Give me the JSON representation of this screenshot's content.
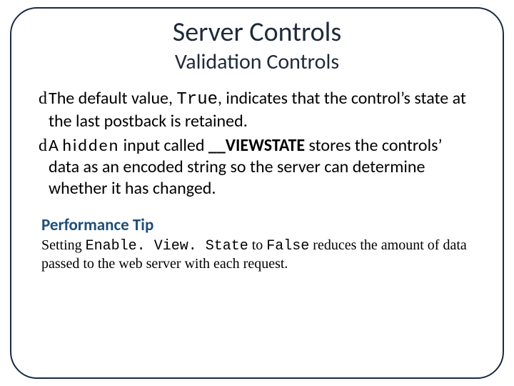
{
  "title": "Server Controls",
  "subtitle": "Validation Controls",
  "bullets": [
    {
      "pre": "The default value, ",
      "code1": "True",
      "post": ", indicates that the control’s state at the last postback is retained."
    },
    {
      "pre": "A ",
      "spaced": "hidden",
      "mid": " input called  ",
      "bold": "__VIEWSTATE",
      "post": " stores the controls’ data as an encoded string so the server can determine whether it has changed."
    }
  ],
  "tip": {
    "header": "Performance Tip",
    "t1": "Setting ",
    "c1": "Enable. View. State",
    "t2": " to ",
    "c2": "False",
    "t3": " reduces the amount of data passed to the web server with each request."
  },
  "marker": "d"
}
